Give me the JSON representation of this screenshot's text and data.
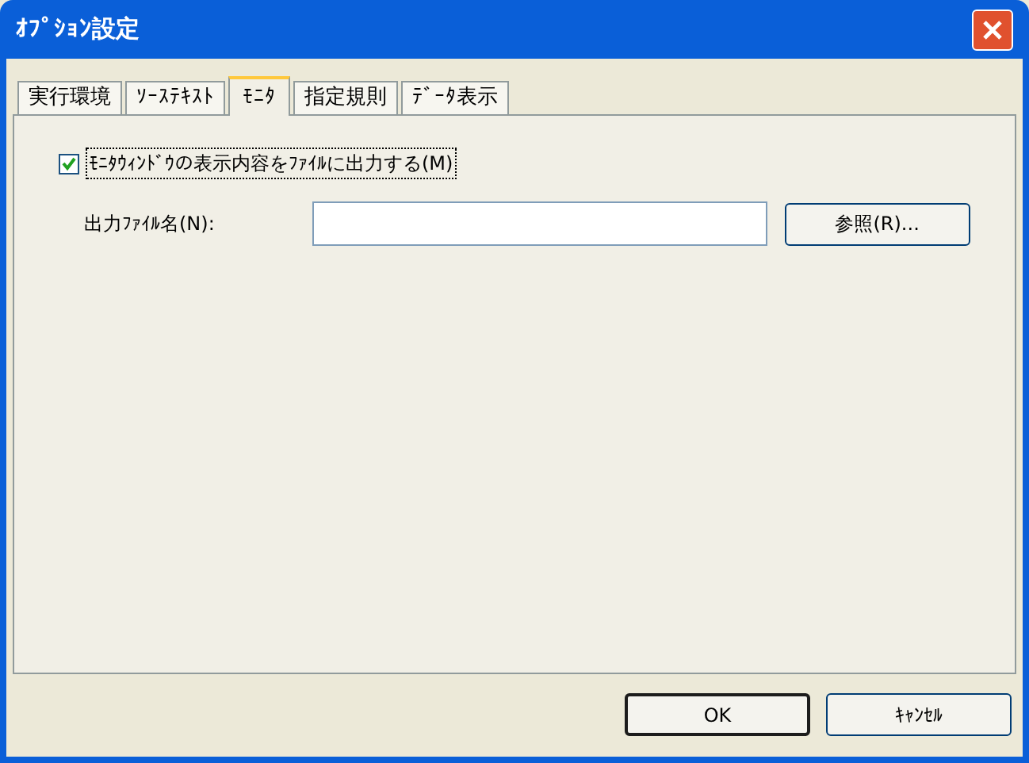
{
  "window": {
    "title": "ｵﾌﾟｼｮﾝ設定"
  },
  "tabs": [
    {
      "label": "実行環境",
      "selected": false
    },
    {
      "label": "ｿｰｽﾃｷｽﾄ",
      "selected": false
    },
    {
      "label": "ﾓﾆﾀ",
      "selected": true
    },
    {
      "label": "指定規則",
      "selected": false
    },
    {
      "label": "ﾃﾞｰﾀ表示",
      "selected": false
    }
  ],
  "output_checkbox": {
    "label": "ﾓﾆﾀｳｨﾝﾄﾞｳの表示内容をﾌｧｲﾙに出力する(M)",
    "checked": true
  },
  "output_file": {
    "label": "出力ﾌｧｲﾙ名(N):",
    "browse_button": "参照(R)..."
  },
  "buttons": [
    "OK",
    "ｷｬﾝｾﾙ"
  ]
}
